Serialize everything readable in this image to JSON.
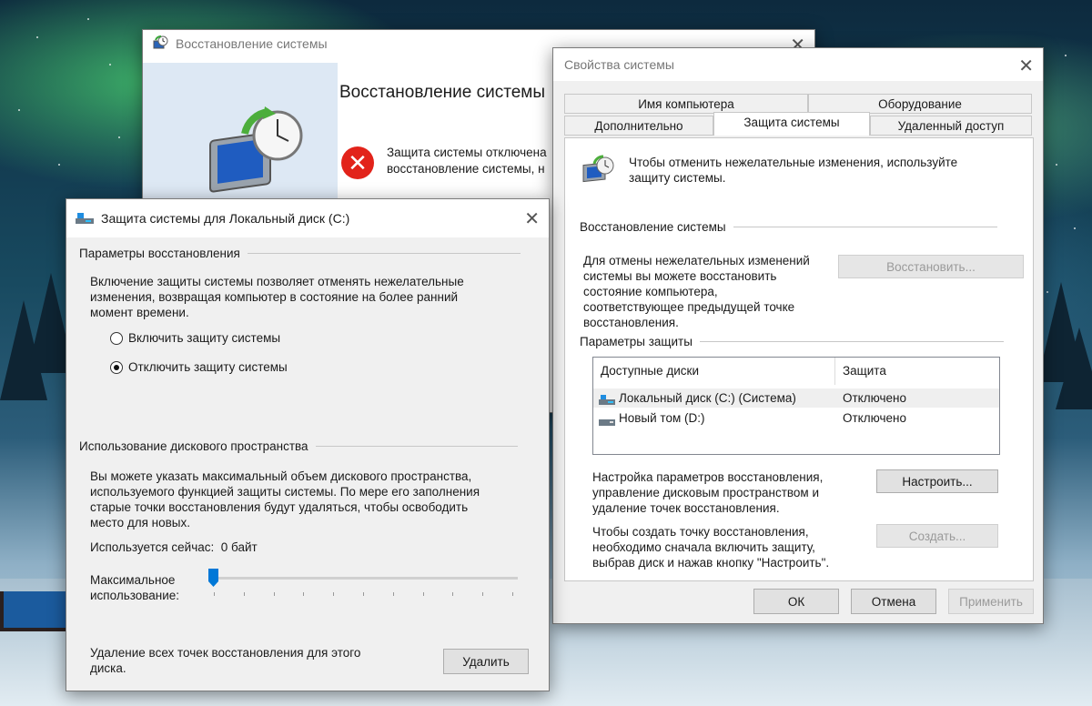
{
  "restore_window": {
    "title": "Восстановление системы",
    "heading": "Восстановление системы",
    "message_line1": "Защита системы отключена",
    "message_line2": "восстановление системы, н"
  },
  "props_window": {
    "title": "Свойства системы",
    "tabs_row1": [
      "Имя компьютера",
      "Оборудование"
    ],
    "tabs_row2": [
      "Дополнительно",
      "Защита системы",
      "Удаленный доступ"
    ],
    "active_tab": "Защита системы",
    "intro_line1": "Чтобы отменить нежелательные изменения, используйте",
    "intro_line2": "защиту системы.",
    "restore_group": "Восстановление системы",
    "restore_text": [
      "Для отмены нежелательных изменений",
      "системы вы можете восстановить",
      "состояние компьютера,",
      "соответствующее предыдущей точке",
      "восстановления."
    ],
    "restore_button": "Восстановить...",
    "protection_group": "Параметры защиты",
    "table_headers": [
      "Доступные диски",
      "Защита"
    ],
    "drives": [
      {
        "name": "Локальный диск (C:) (Система)",
        "status": "Отключено"
      },
      {
        "name": "Новый том (D:)",
        "status": "Отключено"
      }
    ],
    "configure_text": [
      "Настройка параметров восстановления,",
      "управление дисковым пространством и",
      "удаление точек восстановления."
    ],
    "configure_button": "Настроить...",
    "create_text": [
      "Чтобы создать точку восстановления,",
      "необходимо сначала включить защиту,",
      "выбрав диск и нажав кнопку \"Настроить\"."
    ],
    "create_button": "Создать...",
    "ok_button": "ОК",
    "cancel_button": "Отмена",
    "apply_button": "Применить"
  },
  "protection_dialog": {
    "title": "Защита системы для Локальный диск (C:)",
    "restore_settings_group": "Параметры восстановления",
    "restore_desc": [
      "Включение защиты системы позволяет отменять нежелательные",
      "изменения, возвращая компьютер в состояние на более ранний",
      "момент времени."
    ],
    "radio_enable": "Включить защиту системы",
    "radio_disable": "Отключить защиту системы",
    "selected_radio": "disable",
    "disk_usage_group": "Использование дискового пространства",
    "disk_desc": [
      "Вы можете указать максимальный объем дискового пространства,",
      "используемого функцией защиты системы. По мере его заполнения",
      "старые точки восстановления будут удаляться, чтобы освободить",
      "место для новых."
    ],
    "current_usage_label": "Используется сейчас:",
    "current_usage_value": "0 байт",
    "max_usage_label_line1": "Максимальное",
    "max_usage_label_line2": "использование:",
    "max_usage_fraction": 0.0,
    "delete_text": [
      "Удаление всех точек восстановления для этого",
      "диска."
    ],
    "delete_button": "Удалить"
  },
  "colors": {
    "accent": "#0078d7",
    "error": "#e2231a",
    "window_bg": "#f0f0f0"
  }
}
